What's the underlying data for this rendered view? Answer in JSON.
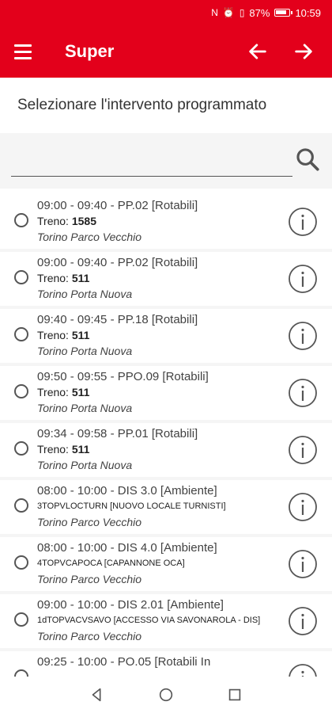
{
  "status_bar": {
    "battery": "87%",
    "time": "10:59",
    "icons": [
      "nfc-icon",
      "alarm-icon",
      "vibrate-icon",
      "battery-icon"
    ]
  },
  "app_bar": {
    "title": "Super",
    "menu_icon": "hamburger-icon",
    "back_icon": "arrow-left-icon",
    "forward_icon": "arrow-right-icon"
  },
  "section_title": "Selezionare l'intervento programmato",
  "search": {
    "value": "",
    "placeholder": ""
  },
  "items": [
    {
      "line1": "09:00 - 09:40 - PP.02 [Rotabili]",
      "prefix": "Treno: ",
      "bold": "1585",
      "detail": "",
      "location": "Torino Parco Vecchio"
    },
    {
      "line1": "09:00 - 09:40 - PP.02 [Rotabili]",
      "prefix": "Treno: ",
      "bold": "511",
      "detail": "",
      "location": "Torino Porta Nuova"
    },
    {
      "line1": "09:40 - 09:45 - PP.18 [Rotabili]",
      "prefix": "Treno: ",
      "bold": "511",
      "detail": "",
      "location": "Torino Porta Nuova"
    },
    {
      "line1": "09:50 - 09:55 - PPO.09 [Rotabili]",
      "prefix": "Treno: ",
      "bold": "511",
      "detail": "",
      "location": "Torino Porta Nuova"
    },
    {
      "line1": "09:34 - 09:58 - PP.01 [Rotabili]",
      "prefix": "Treno: ",
      "bold": "511",
      "detail": "",
      "location": "Torino Porta Nuova"
    },
    {
      "line1": "08:00 - 10:00 - DIS 3.0 [Ambiente]",
      "prefix": "",
      "bold": "",
      "detail": "3TOPVLOCTURN [NUOVO LOCALE TURNISTI]",
      "location": "Torino Parco Vecchio"
    },
    {
      "line1": "08:00 - 10:00 - DIS 4.0 [Ambiente]",
      "prefix": "",
      "bold": "",
      "detail": "4TOPVCAPOCA [CAPANNONE OCA]",
      "location": "Torino Parco Vecchio"
    },
    {
      "line1": "09:00 - 10:00 - DIS 2.01 [Ambiente]",
      "prefix": "",
      "bold": "",
      "detail": "1dTOPVACVSAVO [ACCESSO VIA SAVONAROLA - DIS]",
      "location": "Torino Parco Vecchio"
    },
    {
      "line1": "09:25 - 10:00 - PO.05 [Rotabili In",
      "prefix": "",
      "bold": "",
      "detail": "",
      "location": ""
    }
  ],
  "colors": {
    "brand": "#e3001b",
    "background": "#f5f5f5"
  },
  "nav_bar": {
    "icons": [
      "back-triangle-icon",
      "home-circle-icon",
      "recents-square-icon"
    ]
  }
}
